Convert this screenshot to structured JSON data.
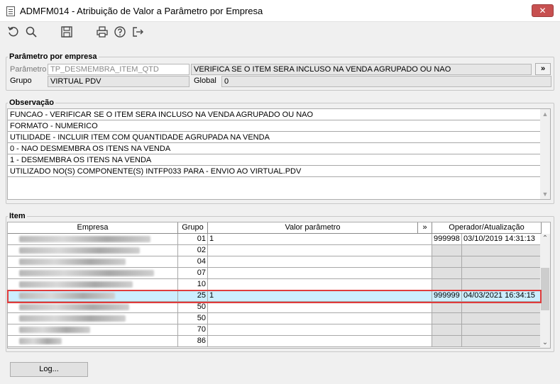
{
  "window": {
    "title": "ADMFM014 - Atribuição de Valor a Parâmetro por Empresa",
    "close_label": "✕"
  },
  "toolbar": {
    "icons": [
      "undo-icon",
      "search-icon",
      "save-icon",
      "print-icon",
      "help-icon",
      "exit-icon"
    ]
  },
  "param": {
    "legend": "Parâmetro por empresa",
    "parametro_label": "Parâmetro",
    "parametro_value": "TP_DESMEMBRA_ITEM_QTD",
    "descricao": "VERIFICA SE O ITEM SERA INCLUSO NA VENDA AGRUPADO OU NAO",
    "more_label": "»",
    "grupo_label": "Grupo",
    "grupo_value": "VIRTUAL PDV",
    "global_label": "Global",
    "global_value": "0"
  },
  "obs": {
    "legend": "Observação",
    "lines": [
      "FUNCAO - VERIFICAR SE O ITEM SERA INCLUSO NA VENDA AGRUPADO OU NAO",
      "FORMATO - NUMERICO",
      "UTILIDADE - INCLUIR ITEM COM QUANTIDADE AGRUPADA NA VENDA",
      "0 - NAO DESMEMBRA OS ITENS NA VENDA",
      "1 - DESMEMBRA OS ITENS NA VENDA",
      "UTILIZADO NO(S) COMPONENTE(S) INTFP033  PARA  - ENVIO AO VIRTUAL.PDV"
    ]
  },
  "item": {
    "legend": "Item",
    "headers": {
      "empresa": "Empresa",
      "grupo": "Grupo",
      "valor": "Valor parâmetro",
      "more": "»",
      "operador": "Operador/Atualização"
    },
    "rows": [
      {
        "grupo": "01",
        "valor": "1",
        "operador": "999998",
        "data": "03/10/2019 14:31:13"
      },
      {
        "grupo": "02",
        "valor": "",
        "operador": "",
        "data": ""
      },
      {
        "grupo": "04",
        "valor": "",
        "operador": "",
        "data": ""
      },
      {
        "grupo": "07",
        "valor": "",
        "operador": "",
        "data": ""
      },
      {
        "grupo": "10",
        "valor": "",
        "operador": "",
        "data": ""
      },
      {
        "grupo": "25",
        "valor": "1",
        "operador": "999999",
        "data": "04/03/2021 16:34:15"
      },
      {
        "grupo": "50",
        "valor": "",
        "operador": "",
        "data": ""
      },
      {
        "grupo": "50",
        "valor": "",
        "operador": "",
        "data": ""
      },
      {
        "grupo": "70",
        "valor": "",
        "operador": "",
        "data": ""
      },
      {
        "grupo": "86",
        "valor": "",
        "operador": "",
        "data": ""
      }
    ]
  },
  "footer": {
    "log_label": "Log..."
  }
}
